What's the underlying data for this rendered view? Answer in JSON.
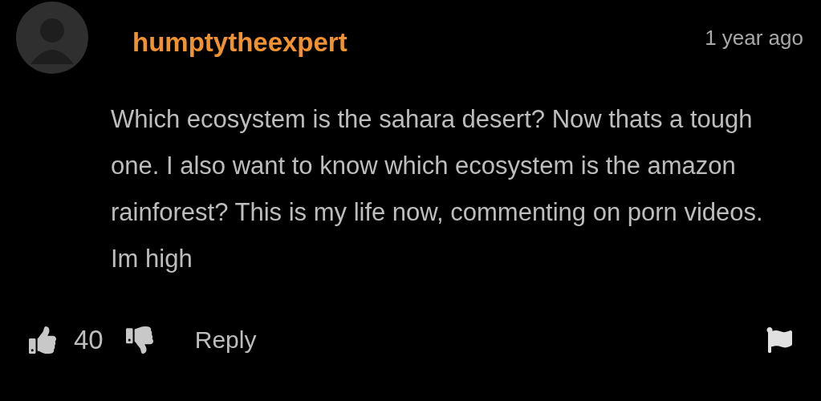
{
  "comment": {
    "author": "humptytheexpert",
    "time": "1 year ago",
    "text": "Which ecosystem is the sahara desert? Now thats a tough one. I also want to know which ecosystem is the amazon rainforest? This is my life now, commenting on porn videos. Im high",
    "likes": "40",
    "reply": "Reply"
  }
}
